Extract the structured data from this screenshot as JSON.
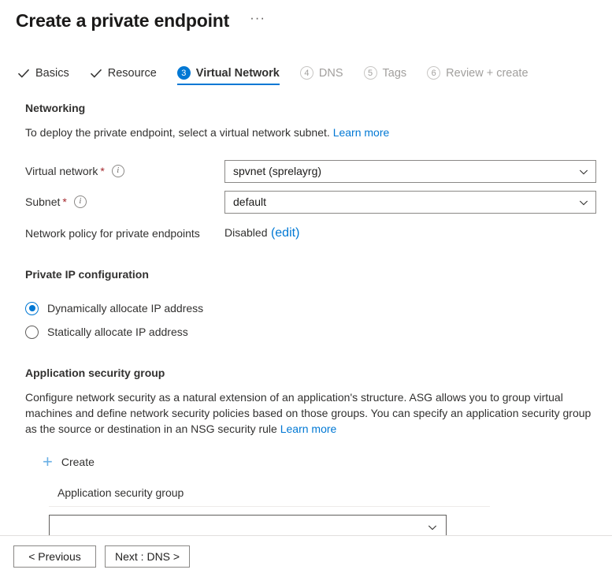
{
  "header": {
    "title": "Create a private endpoint",
    "more_menu": "···"
  },
  "tabs": [
    {
      "label": "Basics",
      "state": "completed",
      "marker": "check"
    },
    {
      "label": "Resource",
      "state": "completed",
      "marker": "check"
    },
    {
      "label": "Virtual Network",
      "state": "active",
      "marker": "3"
    },
    {
      "label": "DNS",
      "state": "disabled",
      "marker": "4"
    },
    {
      "label": "Tags",
      "state": "disabled",
      "marker": "5"
    },
    {
      "label": "Review + create",
      "state": "disabled",
      "marker": "6"
    }
  ],
  "networking": {
    "heading": "Networking",
    "description": "To deploy the private endpoint, select a virtual network subnet.",
    "learn_more": "Learn more",
    "fields": {
      "virtual_network": {
        "label": "Virtual network",
        "required_marker": "*",
        "value": "spvnet (sprelayrg)"
      },
      "subnet": {
        "label": "Subnet",
        "required_marker": "*",
        "value": "default"
      },
      "network_policy": {
        "label": "Network policy for private endpoints",
        "value": "Disabled",
        "edit_link": "(edit)"
      }
    }
  },
  "private_ip": {
    "heading": "Private IP configuration",
    "options": [
      {
        "label": "Dynamically allocate IP address",
        "selected": true
      },
      {
        "label": "Statically allocate IP address",
        "selected": false
      }
    ]
  },
  "asg": {
    "heading": "Application security group",
    "description": "Configure network security as a natural extension of an application's structure. ASG allows you to group virtual machines and define network security policies based on those groups. You can specify an application security group as the source or destination in an NSG security rule",
    "learn_more": "Learn more",
    "create_label": "Create",
    "table_header": "Application security group",
    "row_value": ""
  },
  "footer": {
    "previous_label": "< Previous",
    "next_label": "Next : DNS >"
  },
  "colors": {
    "accent": "#0078d4",
    "link": "#0078d4",
    "required": "#a4262c",
    "disabled_text": "#a19f9d",
    "plus_icon": "#69afe5"
  }
}
